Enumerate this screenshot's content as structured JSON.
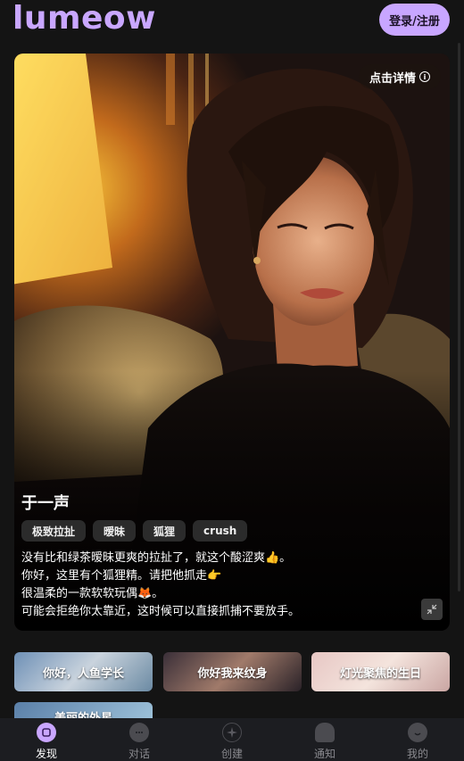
{
  "header": {
    "logo": "lumeow",
    "login_label": "登录/注册"
  },
  "card": {
    "detail_label": "点击详情",
    "name": "于一声",
    "tags": [
      "极致拉扯",
      "暧昧",
      "狐狸",
      "crush"
    ],
    "desc": [
      "没有比和绿茶暧昧更爽的拉扯了，就这个酸涩爽👍。",
      "你好，这里有个狐狸精。请把他抓走👉",
      "很温柔的一款软软玩偶🦊。",
      "可能会拒绝你太靠近，这时候可以直接抓捕不要放手。"
    ]
  },
  "thumbs": [
    "你好，人鱼学长",
    "你好我来纹身",
    "灯光聚焦的生日",
    "美丽的外星"
  ],
  "nav": [
    {
      "label": "发现",
      "icon": "discover-icon"
    },
    {
      "label": "对话",
      "icon": "chat-icon"
    },
    {
      "label": "创建",
      "icon": "create-icon"
    },
    {
      "label": "通知",
      "icon": "notification-icon"
    },
    {
      "label": "我的",
      "icon": "profile-icon"
    }
  ],
  "colors": {
    "accent": "#c8a6ff",
    "background": "#141414",
    "nav_bg": "#1c1d21"
  }
}
